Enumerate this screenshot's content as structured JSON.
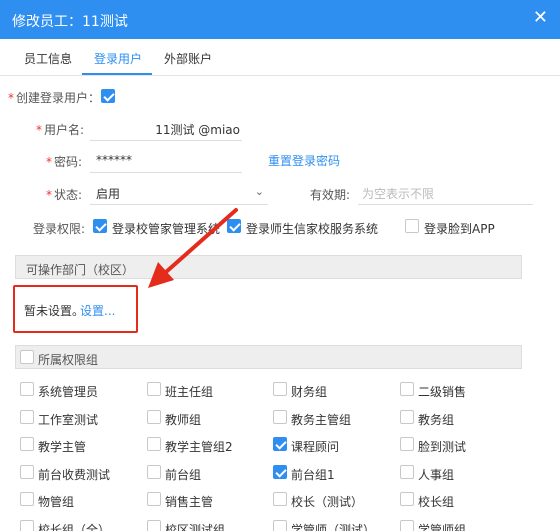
{
  "dialog": {
    "title": "修改员工：11测试",
    "close": "✕"
  },
  "tabs": [
    "员工信息",
    "登录用户",
    "外部账户"
  ],
  "form": {
    "create_login_label": "创建登录用户：",
    "username_label": "用户名:",
    "username_value": "11测试 @miao",
    "password_label": "密码:",
    "password_value": "******",
    "reset_password": "重置登录密码",
    "status_label": "状态:",
    "status_value": "启用",
    "validity_label": "有效期:",
    "validity_placeholder": "为空表示不限",
    "permission_label": "登录权限:",
    "permissions": [
      {
        "label": "登录校管家管理系统",
        "checked": true
      },
      {
        "label": "登录师生信家校服务系统",
        "checked": true
      },
      {
        "label": "登录脸到APP",
        "checked": false
      }
    ]
  },
  "dept_section": {
    "title": "可操作部门（校区）",
    "not_set": "暂未设置。",
    "set_link": "设置..."
  },
  "group_section": {
    "title": "所属权限组",
    "groups": [
      {
        "label": "系统管理员",
        "checked": false
      },
      {
        "label": "班主任组",
        "checked": false
      },
      {
        "label": "财务组",
        "checked": false
      },
      {
        "label": "二级销售",
        "checked": false
      },
      {
        "label": "工作室测试",
        "checked": false
      },
      {
        "label": "教师组",
        "checked": false
      },
      {
        "label": "教务主管组",
        "checked": false
      },
      {
        "label": "教务组",
        "checked": false
      },
      {
        "label": "教学主管",
        "checked": false
      },
      {
        "label": "教学主管组2",
        "checked": false
      },
      {
        "label": "课程顾问",
        "checked": true
      },
      {
        "label": "脸到测试",
        "checked": false
      },
      {
        "label": "前台收费测试",
        "checked": false
      },
      {
        "label": "前台组",
        "checked": false
      },
      {
        "label": "前台组1",
        "checked": true
      },
      {
        "label": "人事组",
        "checked": false
      },
      {
        "label": "物管组",
        "checked": false
      },
      {
        "label": "销售主管",
        "checked": false
      },
      {
        "label": "校长（测试）",
        "checked": false
      },
      {
        "label": "校长组",
        "checked": false
      },
      {
        "label": "校长组（全）",
        "checked": false
      },
      {
        "label": "校区测试组",
        "checked": false
      },
      {
        "label": "学管师（测试）",
        "checked": false
      },
      {
        "label": "学管师组",
        "checked": false
      }
    ]
  },
  "colors": {
    "primary": "#2f8ff0",
    "annotation": "#e52b1c"
  }
}
